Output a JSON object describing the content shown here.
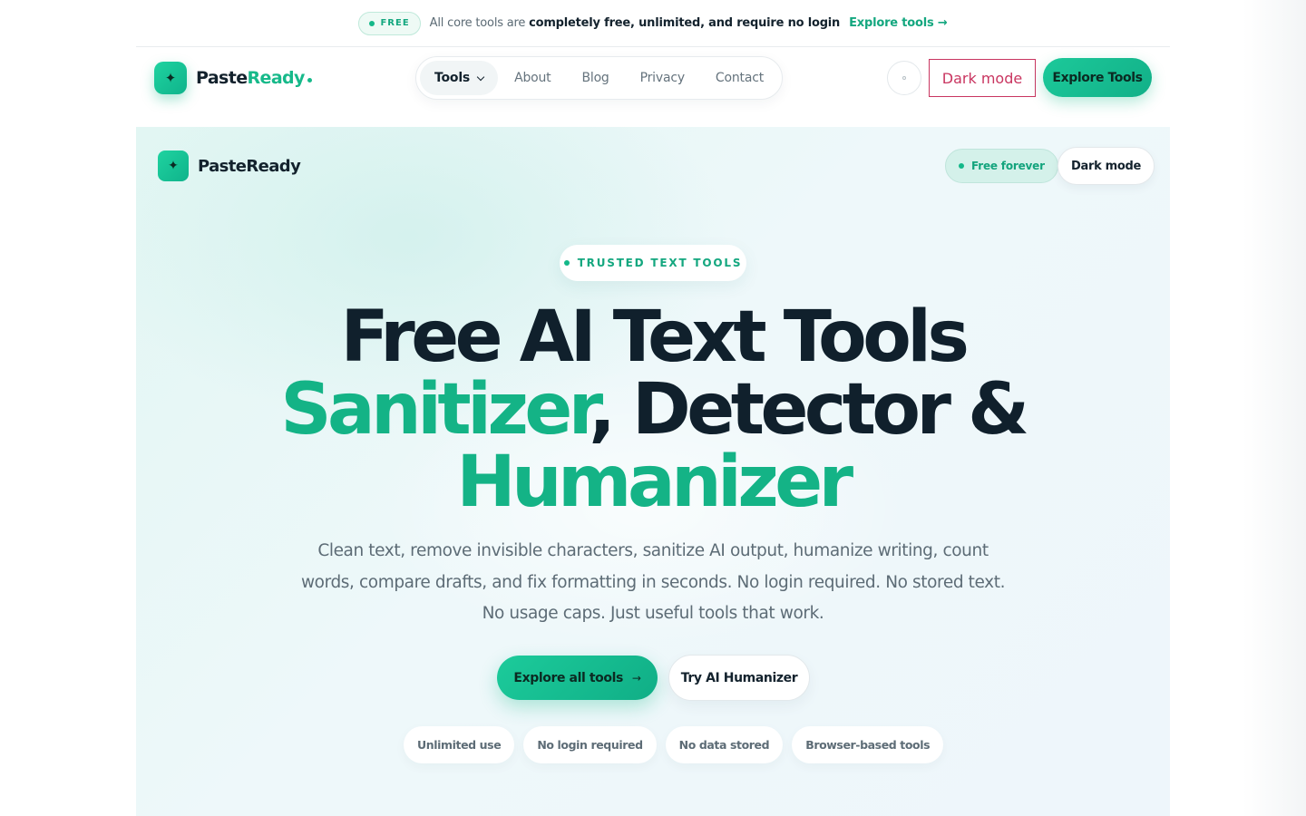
{
  "announcement": {
    "badge": "FREE",
    "message_pre": "All core tools are ",
    "message_bold": "completely free, unlimited, and require no login",
    "link": "Explore tools →"
  },
  "nav": {
    "logo_main": "Paste",
    "logo_accent": "Ready",
    "logo_icon": "sparkle-icon",
    "items": [
      {
        "label": "Tools",
        "active": true
      },
      {
        "label": "About"
      },
      {
        "label": "Blog"
      },
      {
        "label": "Privacy"
      },
      {
        "label": "Contact"
      }
    ],
    "dark_mode": "Dark mode",
    "explore": "Explore Tools"
  },
  "hero": {
    "logo": "PasteReady",
    "free_forever": "Free forever",
    "dark_mode": "Dark mode",
    "badge": "TRUSTED TEXT TOOLS",
    "headline_line1": "Free AI Text Tools",
    "headline_green1": "Sanitizer",
    "headline_rest2": ", Detector &",
    "headline_green3": "Humanizer",
    "subtitle": "Clean text, remove invisible characters, sanitize AI output, humanize writing, count words, compare drafts, and fix formatting in seconds. No login required. No stored text. No usage caps. Just useful tools that work.",
    "cta_primary": "Explore all tools",
    "cta_primary_arrow": "→",
    "cta_secondary": "Try AI Humanizer",
    "chips": [
      "Unlimited use",
      "No login required",
      "No data stored",
      "Browser-based tools"
    ]
  },
  "colors": {
    "accent": "#14b386",
    "dark_mode_border": "#c93560",
    "text": "#10202c"
  }
}
